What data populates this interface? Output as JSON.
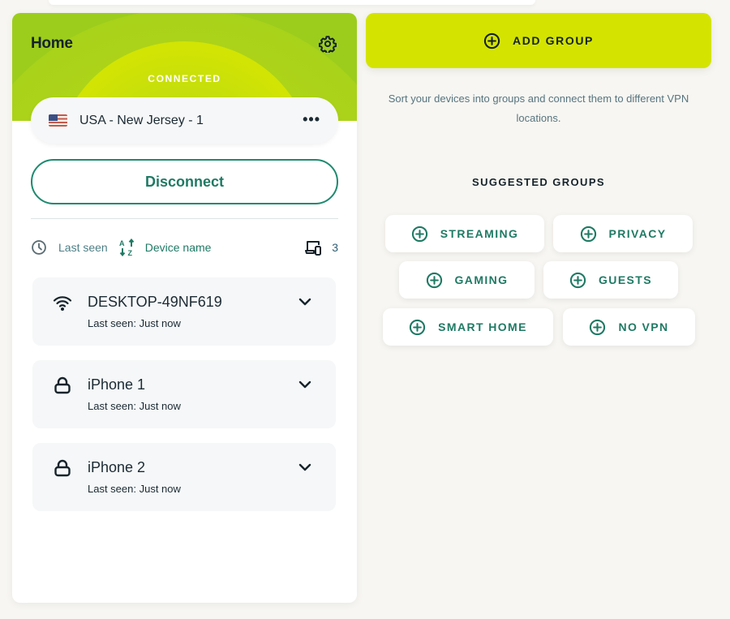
{
  "header": {
    "title": "Home",
    "status": "CONNECTED"
  },
  "location": {
    "flag": "us-flag",
    "name": "USA - New Jersey - 1",
    "more_icon": "more-horizontal-icon"
  },
  "actions": {
    "disconnect_label": "Disconnect"
  },
  "sort": {
    "last_seen_label": "Last seen",
    "device_name_label": "Device name",
    "device_count": "3"
  },
  "devices": [
    {
      "name": "DESKTOP-49NF619",
      "last_seen": "Last seen: Just now",
      "icon": "wifi-icon"
    },
    {
      "name": "iPhone 1",
      "last_seen": "Last seen: Just now",
      "icon": "lock-icon"
    },
    {
      "name": "iPhone 2",
      "last_seen": "Last seen: Just now",
      "icon": "lock-icon"
    }
  ],
  "groups": {
    "add_label": "ADD GROUP",
    "description": "Sort your devices into groups and connect them to different VPN locations.",
    "suggested_title": "SUGGESTED GROUPS",
    "suggested": [
      "STREAMING",
      "PRIVACY",
      "GAMING",
      "GUESTS",
      "SMART HOME",
      "NO VPN"
    ]
  },
  "colors": {
    "accent": "#d4e400",
    "primary_green": "#1f7a64",
    "hero_green": "#9ccd1d",
    "text_dark": "#16232b"
  }
}
